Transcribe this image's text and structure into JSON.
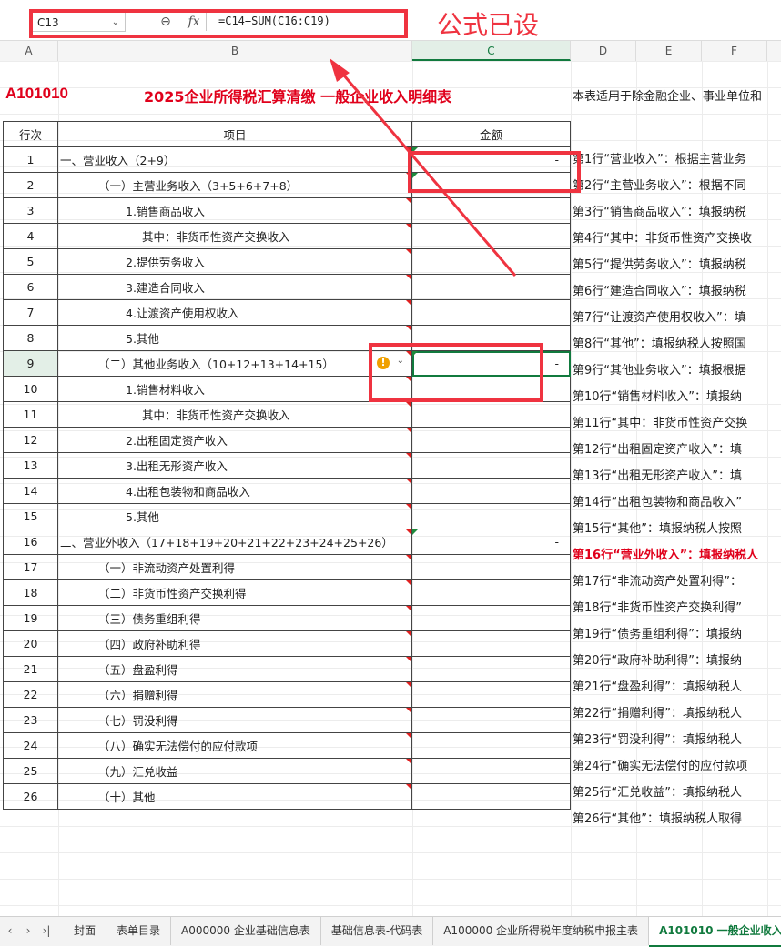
{
  "formula_bar": {
    "cell_ref": "C13",
    "zoom_icon": "magnifier-icon",
    "fx_label": "fx",
    "formula": "=C14+SUM(C16:C19)"
  },
  "columns": [
    "A",
    "B",
    "C",
    "D",
    "E",
    "F"
  ],
  "header": {
    "code": "A101010",
    "title": "2025企业所得税汇算清缴    一般企业收入明细表",
    "note": "本表适用于除金融企业、事业单位和"
  },
  "table": {
    "headers": [
      "行次",
      "项目",
      "金额"
    ],
    "rows": [
      {
        "no": "1",
        "item": "一、营业收入（2+9）",
        "amount": "-"
      },
      {
        "no": "2",
        "item": "（一）主营业务收入（3+5+6+7+8）",
        "amount": "-"
      },
      {
        "no": "3",
        "item": "1.销售商品收入",
        "amount": ""
      },
      {
        "no": "4",
        "item": "其中：非货币性资产交换收入",
        "amount": ""
      },
      {
        "no": "5",
        "item": "2.提供劳务收入",
        "amount": ""
      },
      {
        "no": "6",
        "item": "3.建造合同收入",
        "amount": ""
      },
      {
        "no": "7",
        "item": "4.让渡资产使用权收入",
        "amount": ""
      },
      {
        "no": "8",
        "item": "5.其他",
        "amount": ""
      },
      {
        "no": "9",
        "item": "（二）其他业务收入（10+12+13+14+15）",
        "amount": "-"
      },
      {
        "no": "10",
        "item": "1.销售材料收入",
        "amount": ""
      },
      {
        "no": "11",
        "item": "其中：非货币性资产交换收入",
        "amount": ""
      },
      {
        "no": "12",
        "item": "2.出租固定资产收入",
        "amount": ""
      },
      {
        "no": "13",
        "item": "3.出租无形资产收入",
        "amount": ""
      },
      {
        "no": "14",
        "item": "4.出租包装物和商品收入",
        "amount": ""
      },
      {
        "no": "15",
        "item": "5.其他",
        "amount": ""
      },
      {
        "no": "16",
        "item": "二、营业外收入（17+18+19+20+21+22+23+24+25+26）",
        "amount": "-"
      },
      {
        "no": "17",
        "item": "（一）非流动资产处置利得",
        "amount": ""
      },
      {
        "no": "18",
        "item": "（二）非货币性资产交换利得",
        "amount": ""
      },
      {
        "no": "19",
        "item": "（三）债务重组利得",
        "amount": ""
      },
      {
        "no": "20",
        "item": "（四）政府补助利得",
        "amount": ""
      },
      {
        "no": "21",
        "item": "（五）盘盈利得",
        "amount": ""
      },
      {
        "no": "22",
        "item": "（六）捐赠利得",
        "amount": ""
      },
      {
        "no": "23",
        "item": "（七）罚没利得",
        "amount": ""
      },
      {
        "no": "24",
        "item": "（八）确实无法偿付的应付款项",
        "amount": ""
      },
      {
        "no": "25",
        "item": "（九）汇兑收益",
        "amount": ""
      },
      {
        "no": "26",
        "item": "（十）其他",
        "amount": ""
      }
    ]
  },
  "notes": [
    "第1行“营业收入”：根据主营业务",
    "第2行“主营业务收入”：根据不同",
    "第3行“销售商品收入”：填报纳税",
    "第4行“其中：非货币性资产交换收",
    "第5行“提供劳务收入”：填报纳税",
    "第6行“建造合同收入”：填报纳税",
    "第7行“让渡资产使用权收入”：填",
    "第8行“其他”：填报纳税人按照国",
    "第9行“其他业务收入”：填报根据",
    "第10行“销售材料收入”：填报纳",
    "第11行“其中：非货币性资产交换",
    "第12行“出租固定资产收入”：填",
    "第13行“出租无形资产收入”：填",
    "第14行“出租包装物和商品收入”",
    "第15行“其他”：填报纳税人按照",
    "第16行“营业外收入”：填报纳税人",
    "第17行“非流动资产处置利得”：",
    "第18行“非货币性资产交换利得”",
    "第19行“债务重组利得”：填报纳",
    "第20行“政府补助利得”：填报纳",
    "第21行“盘盈利得”：填报纳税人",
    "第22行“捐赠利得”：填报纳税人",
    "第23行“罚没利得”：填报纳税人",
    "第24行“确实无法偿付的应付款项",
    "第25行“汇兑收益”：填报纳税人",
    "第26行“其他”：填报纳税人取得"
  ],
  "tabs": [
    "封面",
    "表单目录",
    "A000000 企业基础信息表",
    "基础信息表-代码表",
    "A100000 企业所得税年度纳税申报主表",
    "A101010 一般企业收入明"
  ],
  "active_tab_index": 5,
  "annotation": {
    "label": "公式已设",
    "color": "#ef3340"
  },
  "colors": {
    "title_red": "#e0001b",
    "accent_green": "#117a3e",
    "annotation_red": "#ef3340"
  }
}
